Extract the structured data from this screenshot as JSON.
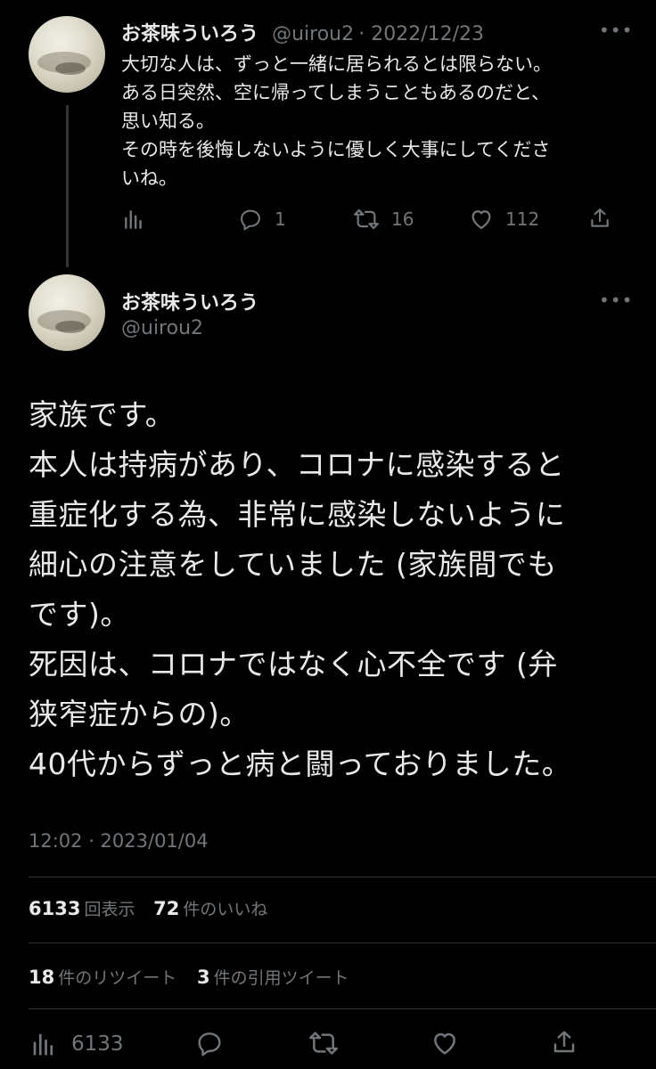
{
  "reply_tweet": {
    "author_name": "お茶味ういろう",
    "handle": "@uirou2",
    "date": "2022/12/23",
    "text": "大切な人は、ずっと一緒に居られるとは限らない。\nある日突然、空に帰ってしまうこともあるのだと、\n思い知る。\nその時を後悔しないように優しく大事にしてくださ\nいね。",
    "analytics_icon": "analytics-icon",
    "reply_count": "1",
    "retweet_count": "16",
    "like_count": "112",
    "share_icon": "share-icon"
  },
  "main_tweet": {
    "author_name": "お茶味ういろう",
    "handle": "@uirou2",
    "text": "家族です。\n本人は持病があり、コロナに感染すると\n重症化する為、非常に感染しないように\n細心の注意をしていました (家族間でも\nです)。\n死因は、コロナではなく心不全です (弁\n狭窄症からの)。\n40代からずっと病と闘っておりました。",
    "timestamp": "12:02 · 2023/01/04"
  },
  "stats": {
    "views_count": "6133",
    "views_label": "回表示",
    "likes_count": "72",
    "likes_label": "件のいいね",
    "retweets_count": "18",
    "retweets_label": "件のリツイート",
    "quotes_count": "3",
    "quotes_label": "件の引用ツイート"
  },
  "bottom_bar": {
    "views_count": "6133"
  },
  "colors": {
    "background": "#000000",
    "text": "#e7e9ea",
    "muted": "#71767b",
    "divider": "#2f3336"
  }
}
